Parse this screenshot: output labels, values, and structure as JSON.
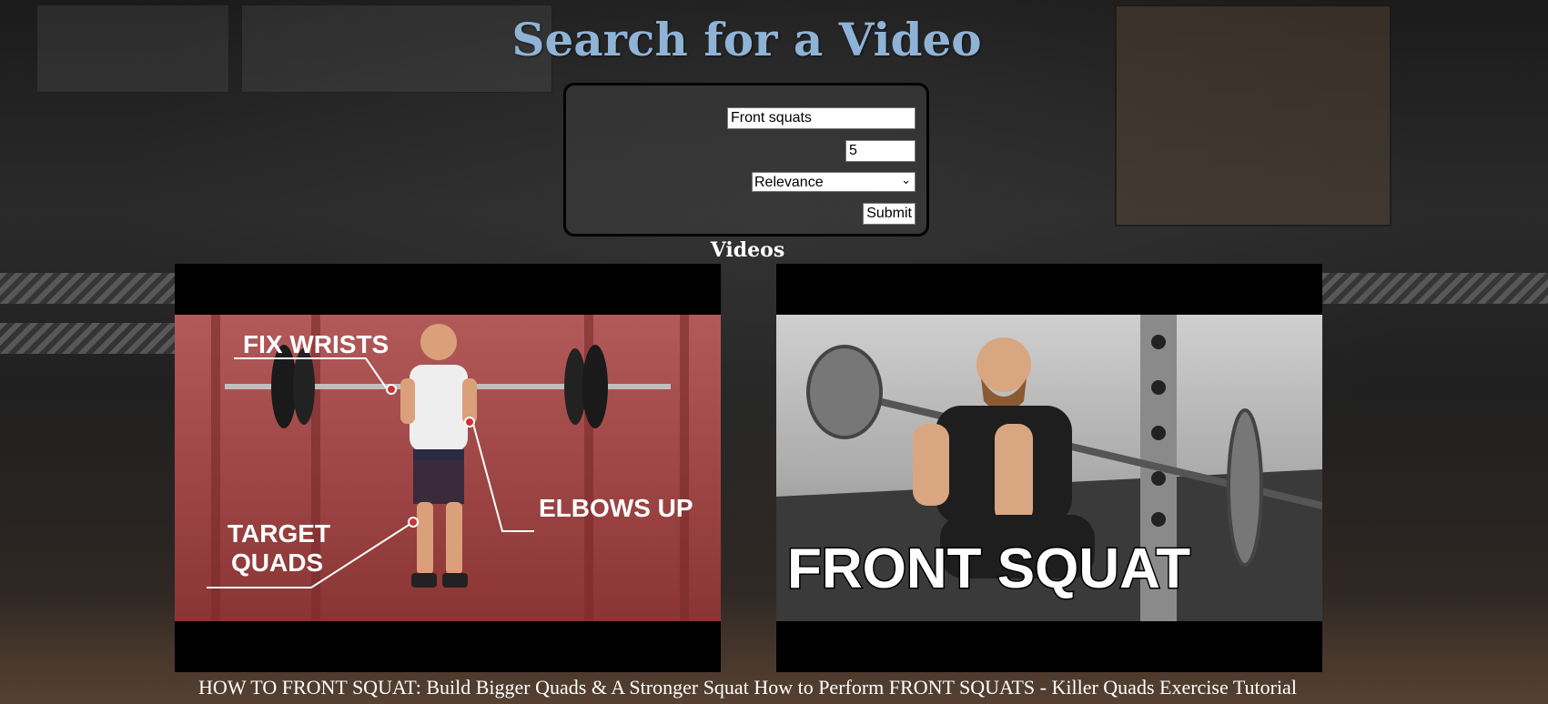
{
  "page": {
    "title": "Search for a Video",
    "videos_heading": "Videos"
  },
  "search_form": {
    "query_value": "Front squats",
    "count_value": "5",
    "order_selected": "Relevance",
    "submit_label": "Submit"
  },
  "videos": [
    {
      "title": "HOW TO FRONT SQUAT: Build Bigger Quads & A Stronger Squat",
      "thumbnail_text": [
        "FIX WRISTS",
        "ELBOWS UP",
        "TARGET",
        "QUADS"
      ]
    },
    {
      "title": "How to Perform FRONT SQUATS - Killer Quads Exercise Tutorial",
      "thumbnail_text": [
        "FRONT SQUAT"
      ]
    }
  ],
  "icons": {
    "dropdown": "chevron-down-icon"
  },
  "colors": {
    "title": "#8fb3d6",
    "heading": "#ffffff",
    "caption": "#ffffff"
  }
}
